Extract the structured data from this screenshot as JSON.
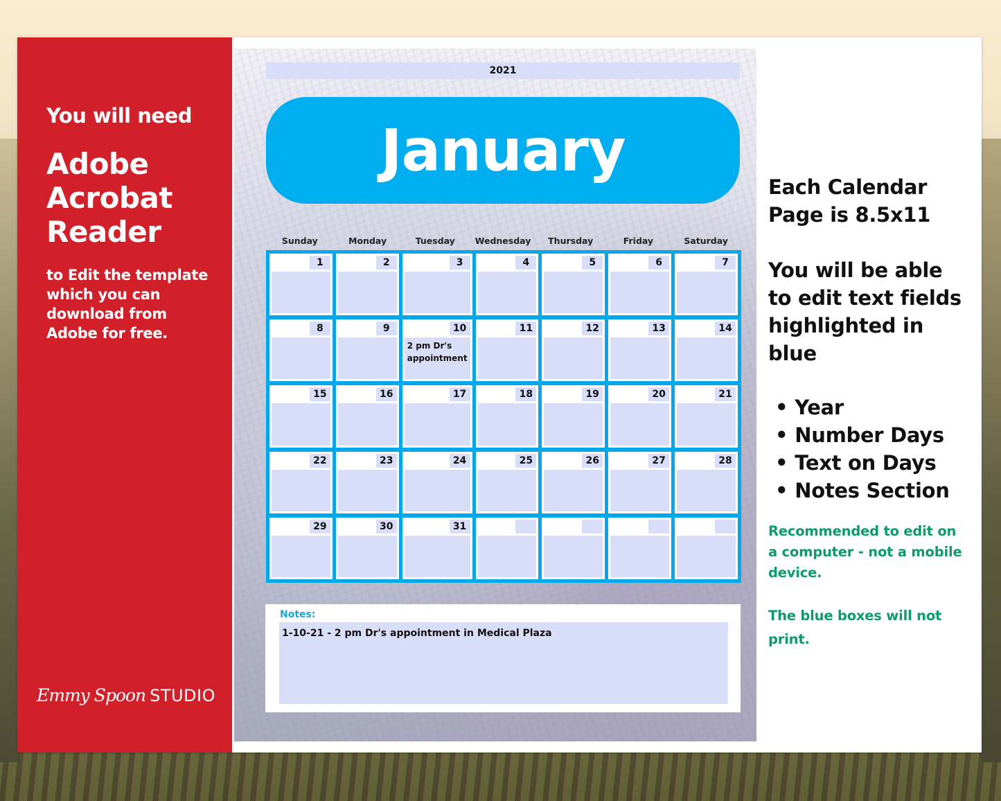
{
  "left_panel": {
    "intro": "You will need",
    "product_lines": [
      "Adobe",
      "Acrobat",
      "Reader"
    ],
    "description_lines": [
      "to Edit the template",
      "which you can",
      "download from",
      "Adobe for  free."
    ],
    "logo": {
      "script": "Emmy Spoon",
      "word": "STUDIO"
    },
    "color": "#d2202a"
  },
  "calendar": {
    "year": "2021",
    "month": "January",
    "accent_color": "#00aeef",
    "field_color": "#d9def8",
    "weekdays": [
      "Sunday",
      "Monday",
      "Tuesday",
      "Wednesday",
      "Thursday",
      "Friday",
      "Saturday"
    ],
    "weeks": [
      [
        {
          "day": "1",
          "text": ""
        },
        {
          "day": "2",
          "text": ""
        },
        {
          "day": "3",
          "text": ""
        },
        {
          "day": "4",
          "text": ""
        },
        {
          "day": "5",
          "text": ""
        },
        {
          "day": "6",
          "text": ""
        },
        {
          "day": "7",
          "text": ""
        }
      ],
      [
        {
          "day": "8",
          "text": ""
        },
        {
          "day": "9",
          "text": ""
        },
        {
          "day": "10",
          "text": "2 pm Dr's appointment"
        },
        {
          "day": "11",
          "text": ""
        },
        {
          "day": "12",
          "text": ""
        },
        {
          "day": "13",
          "text": ""
        },
        {
          "day": "14",
          "text": ""
        }
      ],
      [
        {
          "day": "15",
          "text": ""
        },
        {
          "day": "16",
          "text": ""
        },
        {
          "day": "17",
          "text": ""
        },
        {
          "day": "18",
          "text": ""
        },
        {
          "day": "19",
          "text": ""
        },
        {
          "day": "20",
          "text": ""
        },
        {
          "day": "21",
          "text": ""
        }
      ],
      [
        {
          "day": "22",
          "text": ""
        },
        {
          "day": "23",
          "text": ""
        },
        {
          "day": "24",
          "text": ""
        },
        {
          "day": "25",
          "text": ""
        },
        {
          "day": "26",
          "text": ""
        },
        {
          "day": "27",
          "text": ""
        },
        {
          "day": "28",
          "text": ""
        }
      ],
      [
        {
          "day": "29",
          "text": ""
        },
        {
          "day": "30",
          "text": ""
        },
        {
          "day": "31",
          "text": ""
        },
        {
          "day": "",
          "text": ""
        },
        {
          "day": "",
          "text": ""
        },
        {
          "day": "",
          "text": ""
        },
        {
          "day": "",
          "text": ""
        }
      ]
    ],
    "notes_label": "Notes:",
    "notes_text": "1-10-21 - 2 pm Dr's appointment in Medical Plaza"
  },
  "info": {
    "page_size_lines": [
      "Each Calendar",
      "Page is 8.5x11"
    ],
    "edit_lines": [
      "You will be able",
      "to edit text fields",
      "highlighted in blue"
    ],
    "editable_items": [
      "Year",
      "Number Days",
      "Text on Days",
      "Notes Section"
    ],
    "recommendation_lines": [
      "Recommended to edit on",
      "a computer - not a mobile",
      "device."
    ],
    "print_note_lines": [
      "The blue boxes will not",
      "print."
    ],
    "note_color": "#0f9a6c"
  }
}
